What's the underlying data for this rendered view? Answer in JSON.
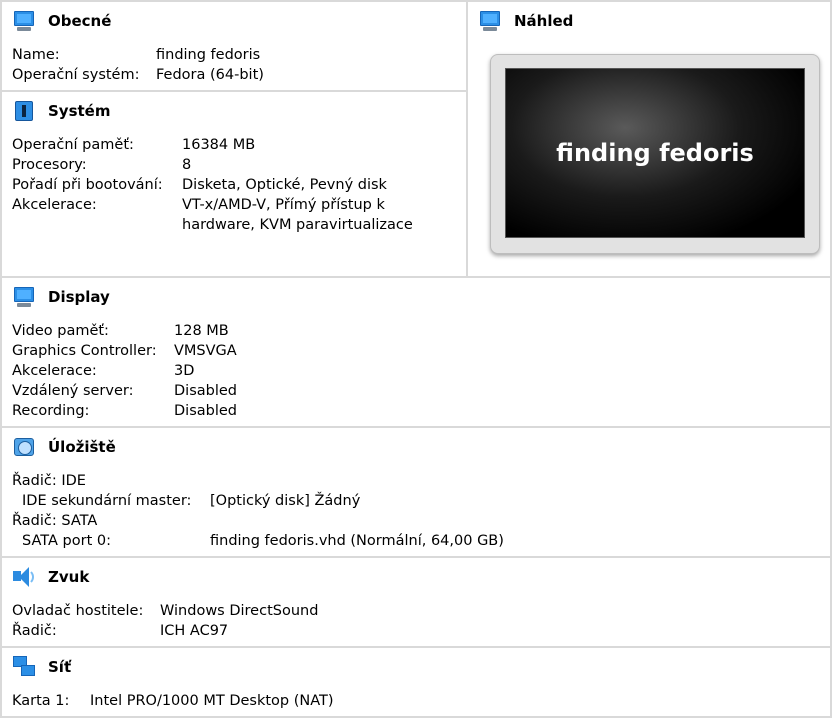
{
  "general": {
    "title": "Obecné",
    "icon": "monitor-icon",
    "rows": [
      {
        "label": "Name:",
        "value": "finding fedoris"
      },
      {
        "label": "Operační systém:",
        "value": "Fedora (64-bit)"
      }
    ]
  },
  "preview": {
    "title": "Náhled",
    "icon": "monitor-icon",
    "screen_text": "finding fedoris"
  },
  "system": {
    "title": "Systém",
    "icon": "chip-icon",
    "rows": [
      {
        "label": "Operační paměť:",
        "value": "16384 MB"
      },
      {
        "label": "Procesory:",
        "value": "8"
      },
      {
        "label": "Pořadí při bootování:",
        "value": "Disketa, Optické, Pevný disk"
      },
      {
        "label": "Akcelerace:",
        "value": "VT-x/AMD-V, Přímý přístup k"
      },
      {
        "label": "",
        "value": "hardware, KVM paravirtualizace"
      }
    ]
  },
  "display": {
    "title": "Display",
    "icon": "monitor-icon",
    "rows": [
      {
        "label": "Video paměť:",
        "value": "128 MB"
      },
      {
        "label": "Graphics Controller:",
        "value": "VMSVGA"
      },
      {
        "label": "Akcelerace:",
        "value": "3D"
      },
      {
        "label": "Vzdálený server:",
        "value": "Disabled"
      },
      {
        "label": "Recording:",
        "value": "Disabled"
      }
    ]
  },
  "storage": {
    "title": "Úložiště",
    "icon": "storage-icon",
    "rows": [
      {
        "label": "Řadič: IDE",
        "value": ""
      },
      {
        "label": "IDE sekundární master:",
        "value": "[Optický disk] Žádný"
      },
      {
        "label": "Řadič: SATA",
        "value": ""
      },
      {
        "label": "SATA port 0:",
        "value": "finding fedoris.vhd (Normální, 64,00 GB)"
      }
    ]
  },
  "audio": {
    "title": "Zvuk",
    "icon": "speaker-icon",
    "rows": [
      {
        "label": "Ovladač hostitele:",
        "value": "Windows DirectSound"
      },
      {
        "label": "Řadič:",
        "value": "ICH AC97"
      }
    ]
  },
  "network": {
    "title": "Síť",
    "icon": "network-icon",
    "rows": [
      {
        "label": "Karta 1:",
        "value": "Intel PRO/1000 MT Desktop (NAT)"
      }
    ]
  }
}
